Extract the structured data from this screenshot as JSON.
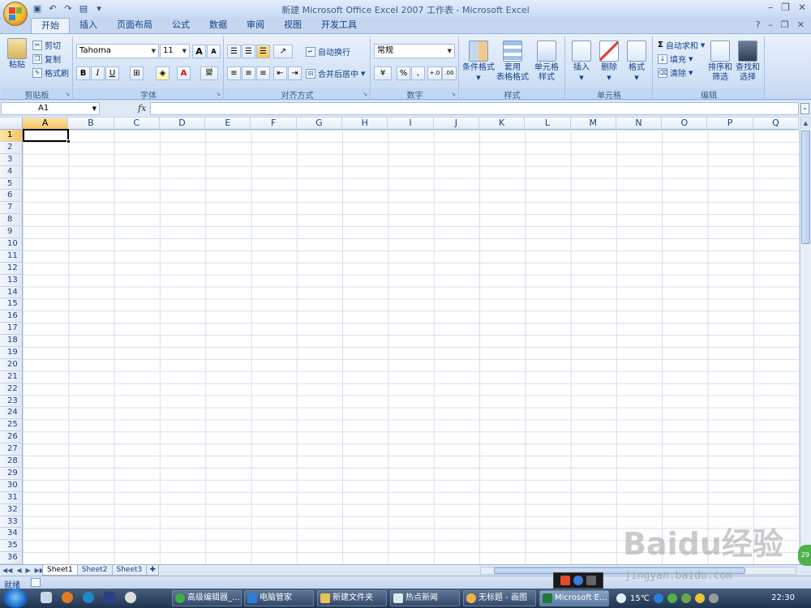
{
  "window": {
    "title": "新建 Microsoft Office Excel 2007 工作表 - Microsoft Excel"
  },
  "tabs": [
    "开始",
    "插入",
    "页面布局",
    "公式",
    "数据",
    "审阅",
    "视图",
    "开发工具"
  ],
  "ribbon": {
    "clipboard": {
      "label": "剪贴板",
      "paste": "粘贴",
      "cut": "剪切",
      "copy": "复制",
      "format_painter": "格式刷"
    },
    "font": {
      "label": "字体",
      "font_name": "Tahoma",
      "font_size": "11",
      "bold": "B",
      "italic": "I",
      "underline": "U",
      "grow": "A",
      "shrink": "A",
      "phonetic": "變"
    },
    "alignment": {
      "label": "对齐方式",
      "wrap_text": "自动换行",
      "merge_center": "合并后居中"
    },
    "number": {
      "label": "数字",
      "format": "常规",
      "percent": "%",
      "comma": ",",
      "inc_decimal": "+.0",
      "dec_decimal": ".00"
    },
    "styles": {
      "label": "样式",
      "conditional": "条件格式",
      "table_format_1": "套用",
      "table_format_2": "表格格式",
      "cell_styles_1": "单元格",
      "cell_styles_2": "样式"
    },
    "cells": {
      "label": "单元格",
      "insert": "插入",
      "delete": "删除",
      "format": "格式"
    },
    "editing": {
      "label": "编辑",
      "autosum": "自动求和",
      "fill": "填充",
      "clear": "清除",
      "sort_1": "排序和",
      "sort_2": "筛选",
      "find_1": "查找和",
      "find_2": "选择"
    }
  },
  "formula_bar": {
    "name_box": "A1",
    "fx": "fx",
    "value": ""
  },
  "columns": [
    "A",
    "B",
    "C",
    "D",
    "E",
    "F",
    "G",
    "H",
    "I",
    "J",
    "K",
    "L",
    "M",
    "N",
    "O",
    "P",
    "Q"
  ],
  "rows": [
    "1",
    "2",
    "3",
    "4",
    "5",
    "6",
    "7",
    "8",
    "9",
    "10",
    "11",
    "12",
    "13",
    "14",
    "15",
    "16",
    "17",
    "18",
    "19",
    "20",
    "21",
    "22",
    "23",
    "24",
    "25",
    "26",
    "27",
    "28",
    "29",
    "30",
    "31",
    "32",
    "33",
    "34",
    "35",
    "36"
  ],
  "sheets": [
    "Sheet1",
    "Sheet2",
    "Sheet3"
  ],
  "status": {
    "text": "就绪"
  },
  "taskbar": {
    "items": [
      "高级编辑器_...",
      "电脑管家",
      "新建文件夹",
      "热点新闻",
      "无标题 - 画图",
      "Microsoft E..."
    ],
    "weather": "15℃",
    "clock": "22:30"
  },
  "watermark": {
    "main": "Baidu经验",
    "sub": "jingyan.baidu.com"
  },
  "badge": "29"
}
